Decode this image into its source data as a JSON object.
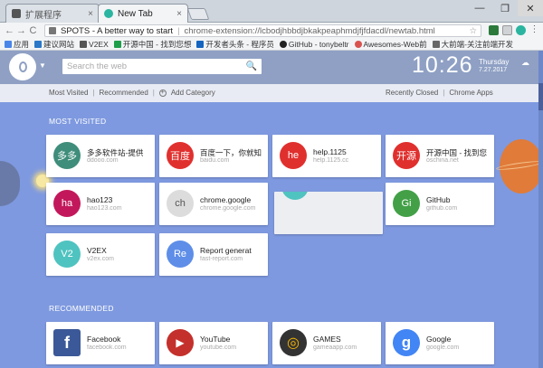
{
  "tabs": [
    {
      "title": "扩展程序",
      "close": "×"
    },
    {
      "title": "New Tab",
      "close": "×"
    }
  ],
  "window_controls": {
    "minimize": "—",
    "restore": "❐",
    "close": "✕"
  },
  "toolbar": {
    "back": "←",
    "forward": "→",
    "reload": "C",
    "site_name": "SPOTS - A better way to start",
    "url": "chrome-extension://lcbodjhbbdjbkakpeaphmdjfjfdacdl/newtab.html",
    "star": "☆"
  },
  "bookmarks": [
    {
      "label": "应用",
      "color": "#4a86e8"
    },
    {
      "label": "建议网站",
      "color": "#2a78c7"
    },
    {
      "label": "V2EX",
      "color": "#555555"
    },
    {
      "label": "开源中国 - 找到您想",
      "color": "#1e9e4a"
    },
    {
      "label": "开发者头条 - 程序员",
      "color": "#1565c0"
    },
    {
      "label": "GitHub - tonybeltr",
      "color": "#222222"
    },
    {
      "label": "Awesomes-Web前",
      "color": "#d9534f"
    },
    {
      "label": "大前端-关注前端开发",
      "color": "#666666"
    }
  ],
  "header": {
    "search_placeholder": "Search the web",
    "time": "10:26",
    "day": "Thursday",
    "date": "7.27.2017",
    "weather_icon": "cloud-icon"
  },
  "subnav": {
    "most_visited": "Most Visited",
    "recommended": "Recommended",
    "add_category": "Add Category",
    "recently_closed": "Recently Closed",
    "chrome_apps": "Chrome Apps"
  },
  "sections": {
    "most_visited": "MOST VISITED",
    "recommended": "RECOMMENDED"
  },
  "most_visited": [
    {
      "icon": "多多",
      "title": "多多软件站-提供",
      "domain": "ddooo.com",
      "color": "#3f8d7b"
    },
    {
      "icon": "百度",
      "title": "百度一下，你就知",
      "domain": "baidu.com",
      "color": "#e0302e"
    },
    {
      "icon": "he",
      "title": "help.1125",
      "domain": "help.1125.cc",
      "color": "#e0302e"
    },
    {
      "icon": "开源",
      "title": "开源中国 - 找到您",
      "domain": "oschina.net",
      "color": "#e0302e"
    },
    {
      "icon": "ha",
      "title": "hao123",
      "domain": "hao123.com",
      "color": "#c2185b"
    },
    {
      "icon": "ch",
      "title": "chrome.google",
      "domain": "chrome.google.com",
      "color": "#dcdcdc"
    },
    {
      "icon": "",
      "title": "",
      "domain": "",
      "color": "#4fc3c0"
    },
    {
      "icon": "Gi",
      "title": "GitHub",
      "domain": "github.com",
      "color": "#43a047"
    },
    {
      "icon": "V2",
      "title": "V2EX",
      "domain": "v2ex.com",
      "color": "#4fc3c0"
    },
    {
      "icon": "Re",
      "title": "Report generat",
      "domain": "fast-report.com",
      "color": "#5e8ee8"
    }
  ],
  "recommended": [
    {
      "title": "Facebook",
      "domain": "facebook.com",
      "color": "#3b5998",
      "glyph": "f"
    },
    {
      "title": "YouTube",
      "domain": "youtube.com",
      "color": "#c4302b",
      "glyph": "▶"
    },
    {
      "title": "GAMES",
      "domain": "gameaapp.com",
      "color": "#333333",
      "glyph": "◎"
    },
    {
      "title": "Google",
      "domain": "google.com",
      "color": "#4285f4",
      "glyph": "g"
    }
  ]
}
